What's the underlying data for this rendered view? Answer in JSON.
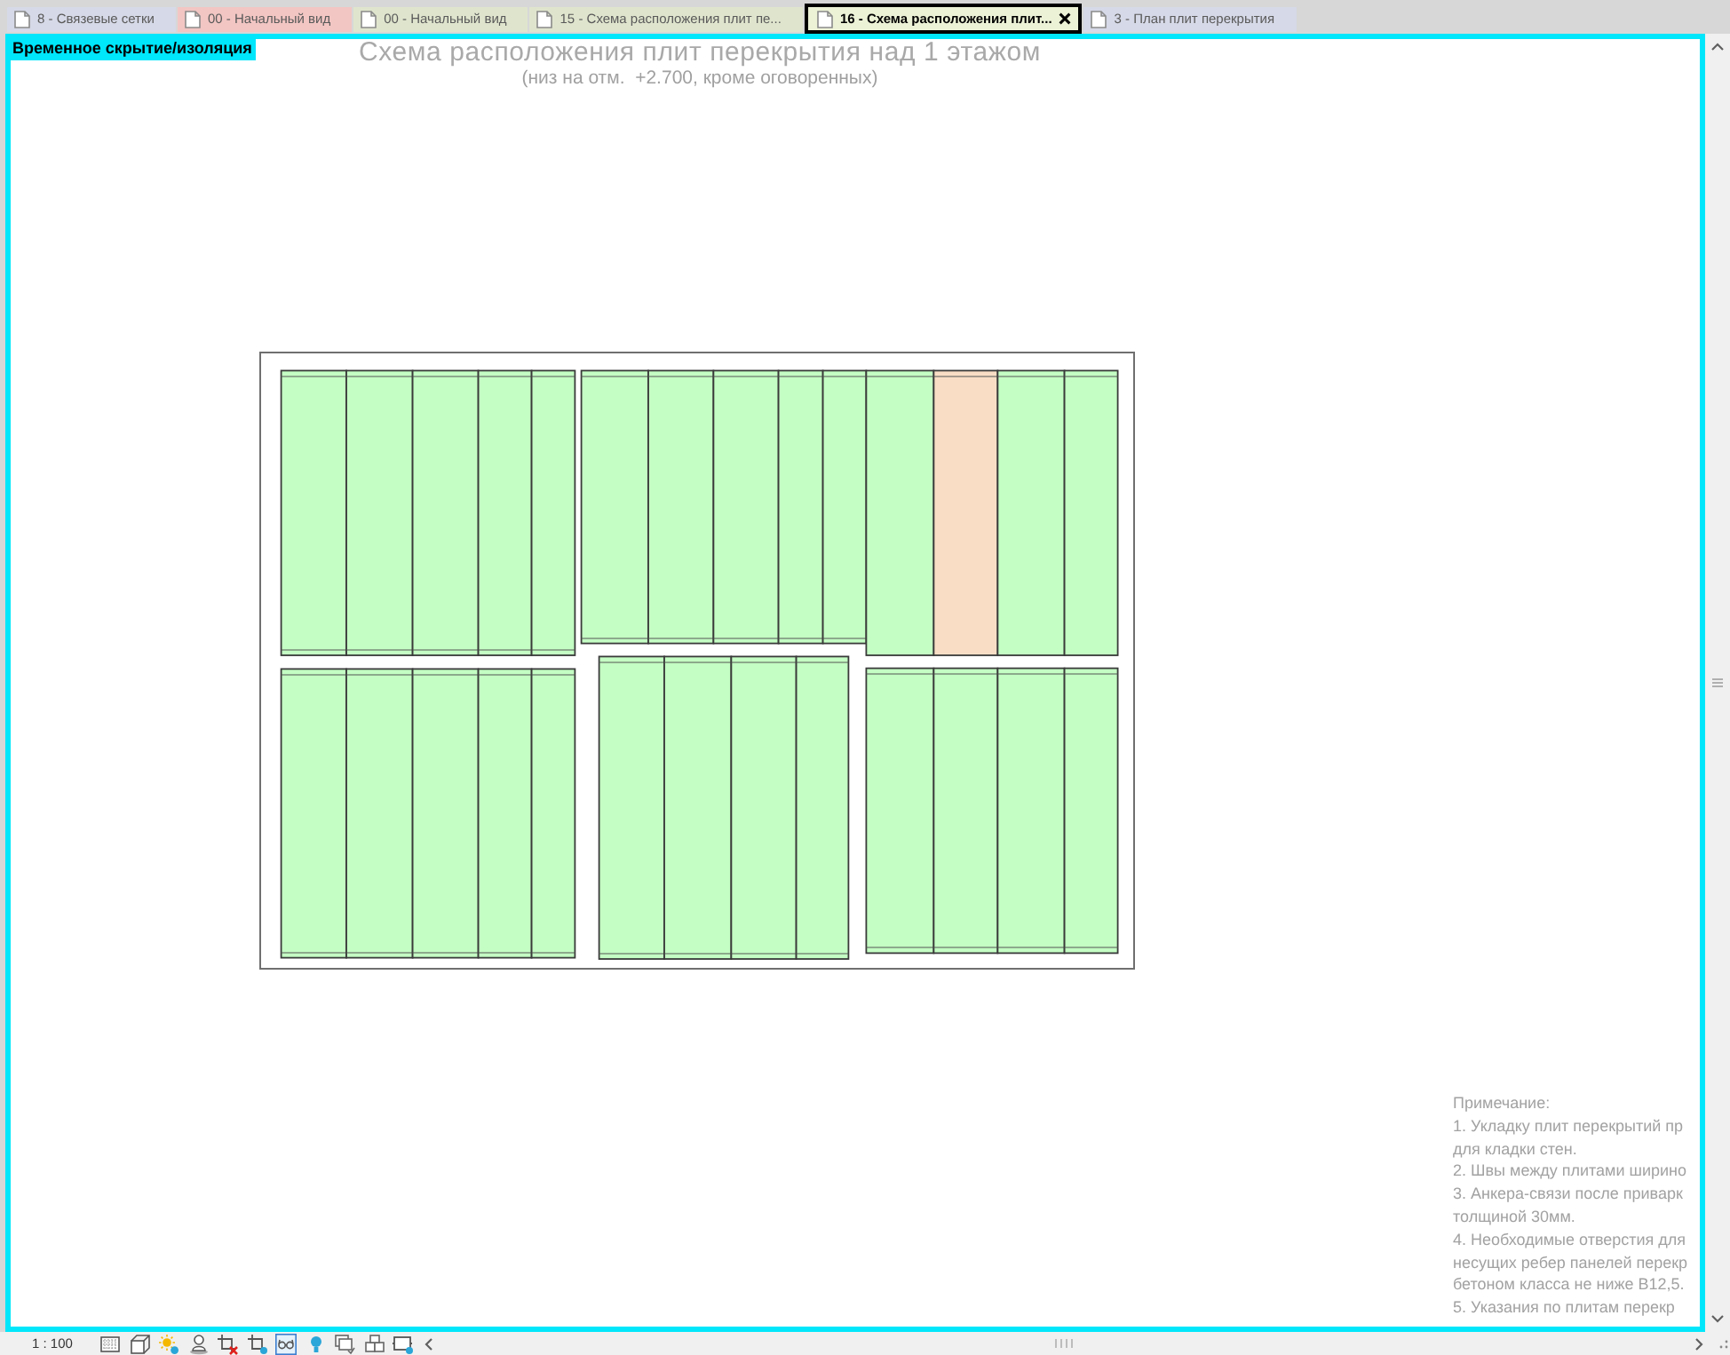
{
  "tabs": [
    {
      "label": "8 - Связевые сетки",
      "color": "#d6d9e7",
      "selected": false
    },
    {
      "label": "00 - Начальный вид",
      "color": "#f2c6c3",
      "selected": false
    },
    {
      "label": "00 - Начальный вид",
      "color": "#dfe5cd",
      "selected": false
    },
    {
      "label": "15 - Схема расположения плит пе...",
      "color": "#dfe5cd",
      "selected": false
    },
    {
      "label": "16 - Схема расположения плит...",
      "color": "#ecf2d6",
      "selected": true
    },
    {
      "label": "3 - План плит перекрытия",
      "color": "#d6d9e7",
      "selected": false
    }
  ],
  "view": {
    "mode_label": "Временное скрытие/изоляция",
    "title": "Схема расположения плит перекрытия над 1 этажом",
    "subtitle": "(низ на отм.  +2.700, кроме оговоренных)",
    "plan": {
      "slabs": [
        {
          "highlighted": false
        },
        {
          "highlighted": false
        },
        {
          "highlighted": false
        },
        {
          "highlighted": false
        },
        {
          "highlighted": false
        },
        {
          "highlighted": false
        },
        {
          "highlighted": false
        },
        {
          "highlighted": false
        },
        {
          "highlighted": false
        },
        {
          "highlighted": false
        },
        {
          "highlighted": false
        },
        {
          "highlighted": true
        },
        {
          "highlighted": false
        },
        {
          "highlighted": false
        },
        {
          "highlighted": false
        },
        {
          "highlighted": false
        },
        {
          "highlighted": false
        },
        {
          "highlighted": false
        },
        {
          "highlighted": false
        },
        {
          "highlighted": false
        },
        {
          "highlighted": false
        },
        {
          "highlighted": false
        },
        {
          "highlighted": false
        },
        {
          "highlighted": false
        },
        {
          "highlighted": false
        },
        {
          "highlighted": false
        },
        {
          "highlighted": false
        }
      ]
    },
    "notes": {
      "heading": "Примечание:",
      "lines": [
        "1. Укладку плит перекрытий пр",
        "для кладки стен.",
        "2. Швы между плитами ширино",
        "3. Анкера-связи после приварк",
        "толщиной 30мм.",
        "4. Необходимые отверстия для",
        "несущих ребер панелей перекр",
        "бетоном класса не ниже В12,5.",
        "5. Указания по плитам перекр"
      ]
    }
  },
  "status_bar": {
    "scale": "1 : 100",
    "view_controls": [
      {
        "active": false
      },
      {
        "active": false
      },
      {
        "active": false
      },
      {
        "active": false
      },
      {
        "active": false
      },
      {
        "active": false
      },
      {
        "active": true
      },
      {
        "active": false
      },
      {
        "active": false
      },
      {
        "active": false
      },
      {
        "active": false
      }
    ]
  }
}
